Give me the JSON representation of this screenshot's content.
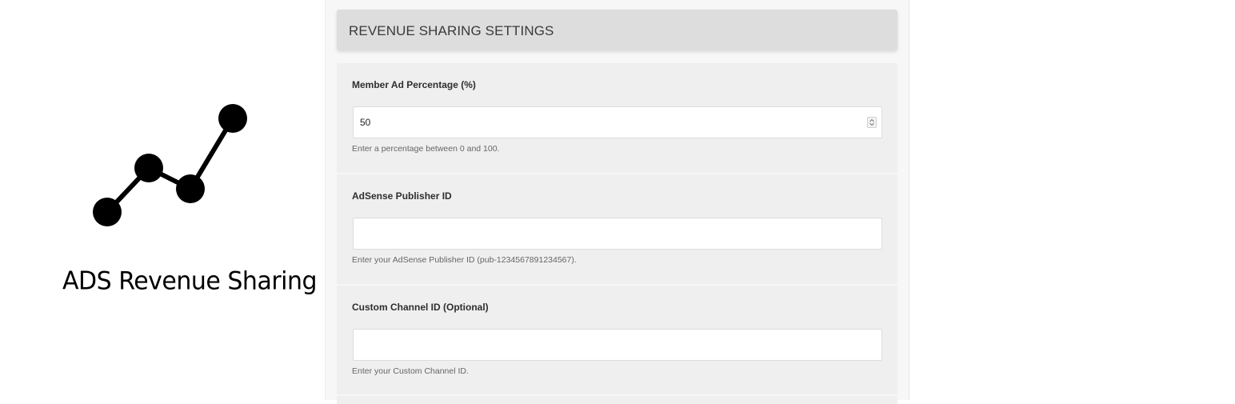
{
  "logo": {
    "title": "ADS Revenue Sharing",
    "icon": "line-graph-icon"
  },
  "settings": {
    "header": "REVENUE SHARING SETTINGS",
    "fields": [
      {
        "label": "Member Ad Percentage (%)",
        "value": "50",
        "help": "Enter a percentage between 0 and 100.",
        "type": "number"
      },
      {
        "label": "AdSense Publisher ID",
        "value": "",
        "help": "Enter your AdSense Publisher ID (pub-1234567891234567).",
        "type": "text"
      },
      {
        "label": "Custom Channel ID (Optional)",
        "value": "",
        "help": "Enter your Custom Channel ID.",
        "type": "text"
      }
    ]
  },
  "colors": {
    "header_bg": "#dddddd",
    "block_bg": "#efefef",
    "panel_bg": "#f7f7f7"
  }
}
